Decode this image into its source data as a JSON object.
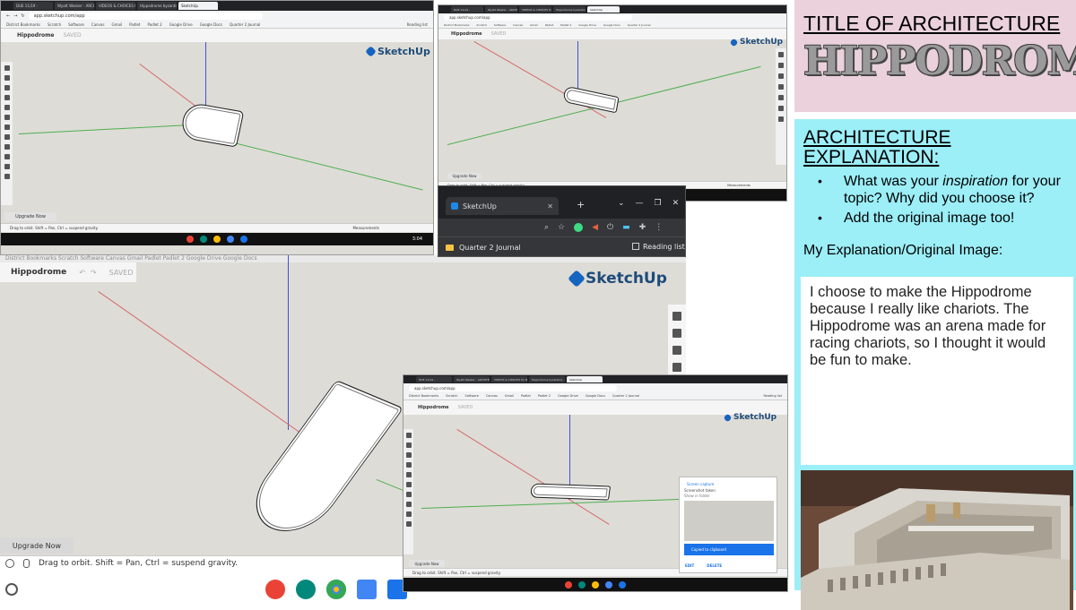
{
  "slide": {
    "title_label": "TITLE OF ARCHITECTURE",
    "title_value": "HIPPODROME",
    "explanation_heading": "ARCHITECTURE EXPLANATION:",
    "bullets": [
      {
        "before": "What was your ",
        "emph": "inspiration",
        "after": " for your topic?  Why did you choose it?"
      },
      {
        "before": "Add the original image too!",
        "emph": "",
        "after": ""
      }
    ],
    "my_explanation_label": "My Explanation/Original Image:",
    "my_explanation_text": "I choose to make the Hippodrome because I really like chariots. The Hippodrome was an arena made for racing chariots, so I thought it would be fun to make."
  },
  "shot1": {
    "tabs": [
      "DUE 11/19 -",
      "Wyatt Wesker - ARCHITEC",
      "VIDEOS & CHOICES for Bu",
      "Hippodrome byzantine - Go",
      "SketchUp"
    ],
    "url": "app.sketchup.com/app",
    "bookmarks": [
      "District Bookmarks",
      "Scratch",
      "Software",
      "Canvas",
      "Gmail",
      "Padlet",
      "Padlet 2",
      "Google Drive",
      "Google Docs",
      "Quarter 2 Journal"
    ],
    "reading_list": "Reading list",
    "model_name": "Hippodrome",
    "saved": "SAVED",
    "logo": "SketchUp",
    "upgrade": "Upgrade Now",
    "status": "Drag to orbit. Shift = Pan, Ctrl = suspend gravity.",
    "measurements": "Measurements",
    "time": "3:04"
  },
  "shot2": {
    "tabs": [
      "DUE 11/19 -",
      "Wyatt Wesker - ARCHITEC",
      "VIDEOS & CHOICES for Bu",
      "Hippodrome byzantine - Go",
      "SketchUp"
    ],
    "url": "app.sketchup.com/app",
    "bookmarks": [
      "District Bookmarks",
      "Scratch",
      "Software",
      "Canvas",
      "Gmail",
      "Padlet",
      "Padlet 2",
      "Google Drive",
      "Google Docs",
      "Quarter 2 Journal"
    ],
    "model_name": "Hippodrome",
    "saved": "SAVED",
    "logo": "SketchUp",
    "upgrade": "Upgrade Now",
    "status": "Drag to orbit. Shift = Pan, Ctrl = suspend gravity.",
    "measurements": "Measurements"
  },
  "popup": {
    "tab_title": "SketchUp",
    "bookmark": "Quarter 2 Journal",
    "reading_list": "Reading list"
  },
  "bigshot": {
    "bookmarks_strip": "District Bookmarks   Scratch   Software   Canvas   Gmail   Padlet   Padlet 2   Google Drive   Google Docs",
    "model_name": "Hippodrome",
    "saved": "SAVED",
    "logo": "SketchUp",
    "upgrade": "Upgrade Now",
    "status": "Drag to orbit. Shift = Pan, Ctrl = suspend gravity."
  },
  "shot3": {
    "tabs": [
      "DUE 11/19 -",
      "Wyatt Wesker - ARCHITEC",
      "VIDEOS & CHOICES for Bu",
      "Hippodrome byzantine - Go",
      "SketchUp"
    ],
    "url": "app.sketchup.com/app",
    "bookmarks": [
      "District Bookmarks",
      "Scratch",
      "Software",
      "Canvas",
      "Gmail",
      "Padlet",
      "Padlet 2",
      "Google Drive",
      "Google Docs",
      "Quarter 2 Journal"
    ],
    "reading_list": "Reading list",
    "model_name": "Hippodrome",
    "saved": "SAVED",
    "logo": "SketchUp",
    "upgrade": "Upgrade Now",
    "status": "Drag to orbit. Shift = Pan, Ctrl = suspend gravity."
  },
  "notification": {
    "app": "Screen capture",
    "title": "Screenshot taken",
    "subtitle": "Show in folder",
    "copied": "Copied to clipboard",
    "edit": "EDIT",
    "delete": "DELETE"
  },
  "colors": {
    "title_bg": "#ead1dc",
    "explain_bg": "#9ceef7",
    "sketchup_blue": "#1565c0",
    "viewport_bg": "#dedcd6"
  }
}
